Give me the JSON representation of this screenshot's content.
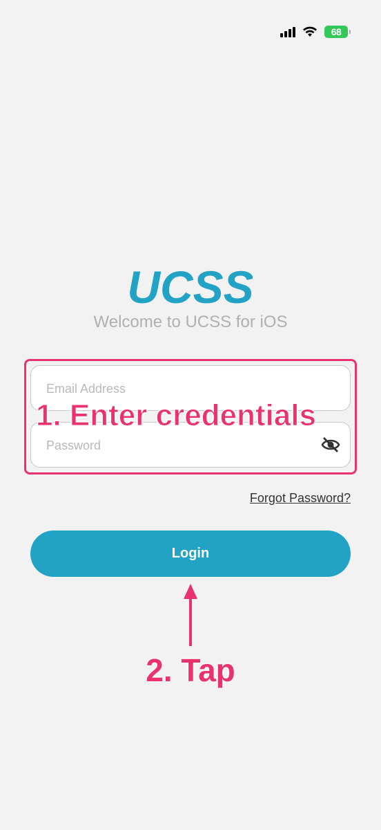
{
  "status_bar": {
    "battery": "68"
  },
  "app": {
    "logo_text": "UCSS",
    "welcome": "Welcome to UCSS for iOS"
  },
  "form": {
    "email_placeholder": "Email Address",
    "password_placeholder": "Password",
    "forgot_label": "Forgot Password?",
    "login_label": "Login"
  },
  "annotations": {
    "step1": "1. Enter credentials",
    "step2": "2. Tap"
  },
  "colors": {
    "brand": "#22a3c6",
    "annotation": "#e8336d",
    "battery": "#34c759"
  },
  "icons": [
    "signal-icon",
    "wifi-icon",
    "battery-icon",
    "eye-slash-icon",
    "up-arrow-icon"
  ]
}
